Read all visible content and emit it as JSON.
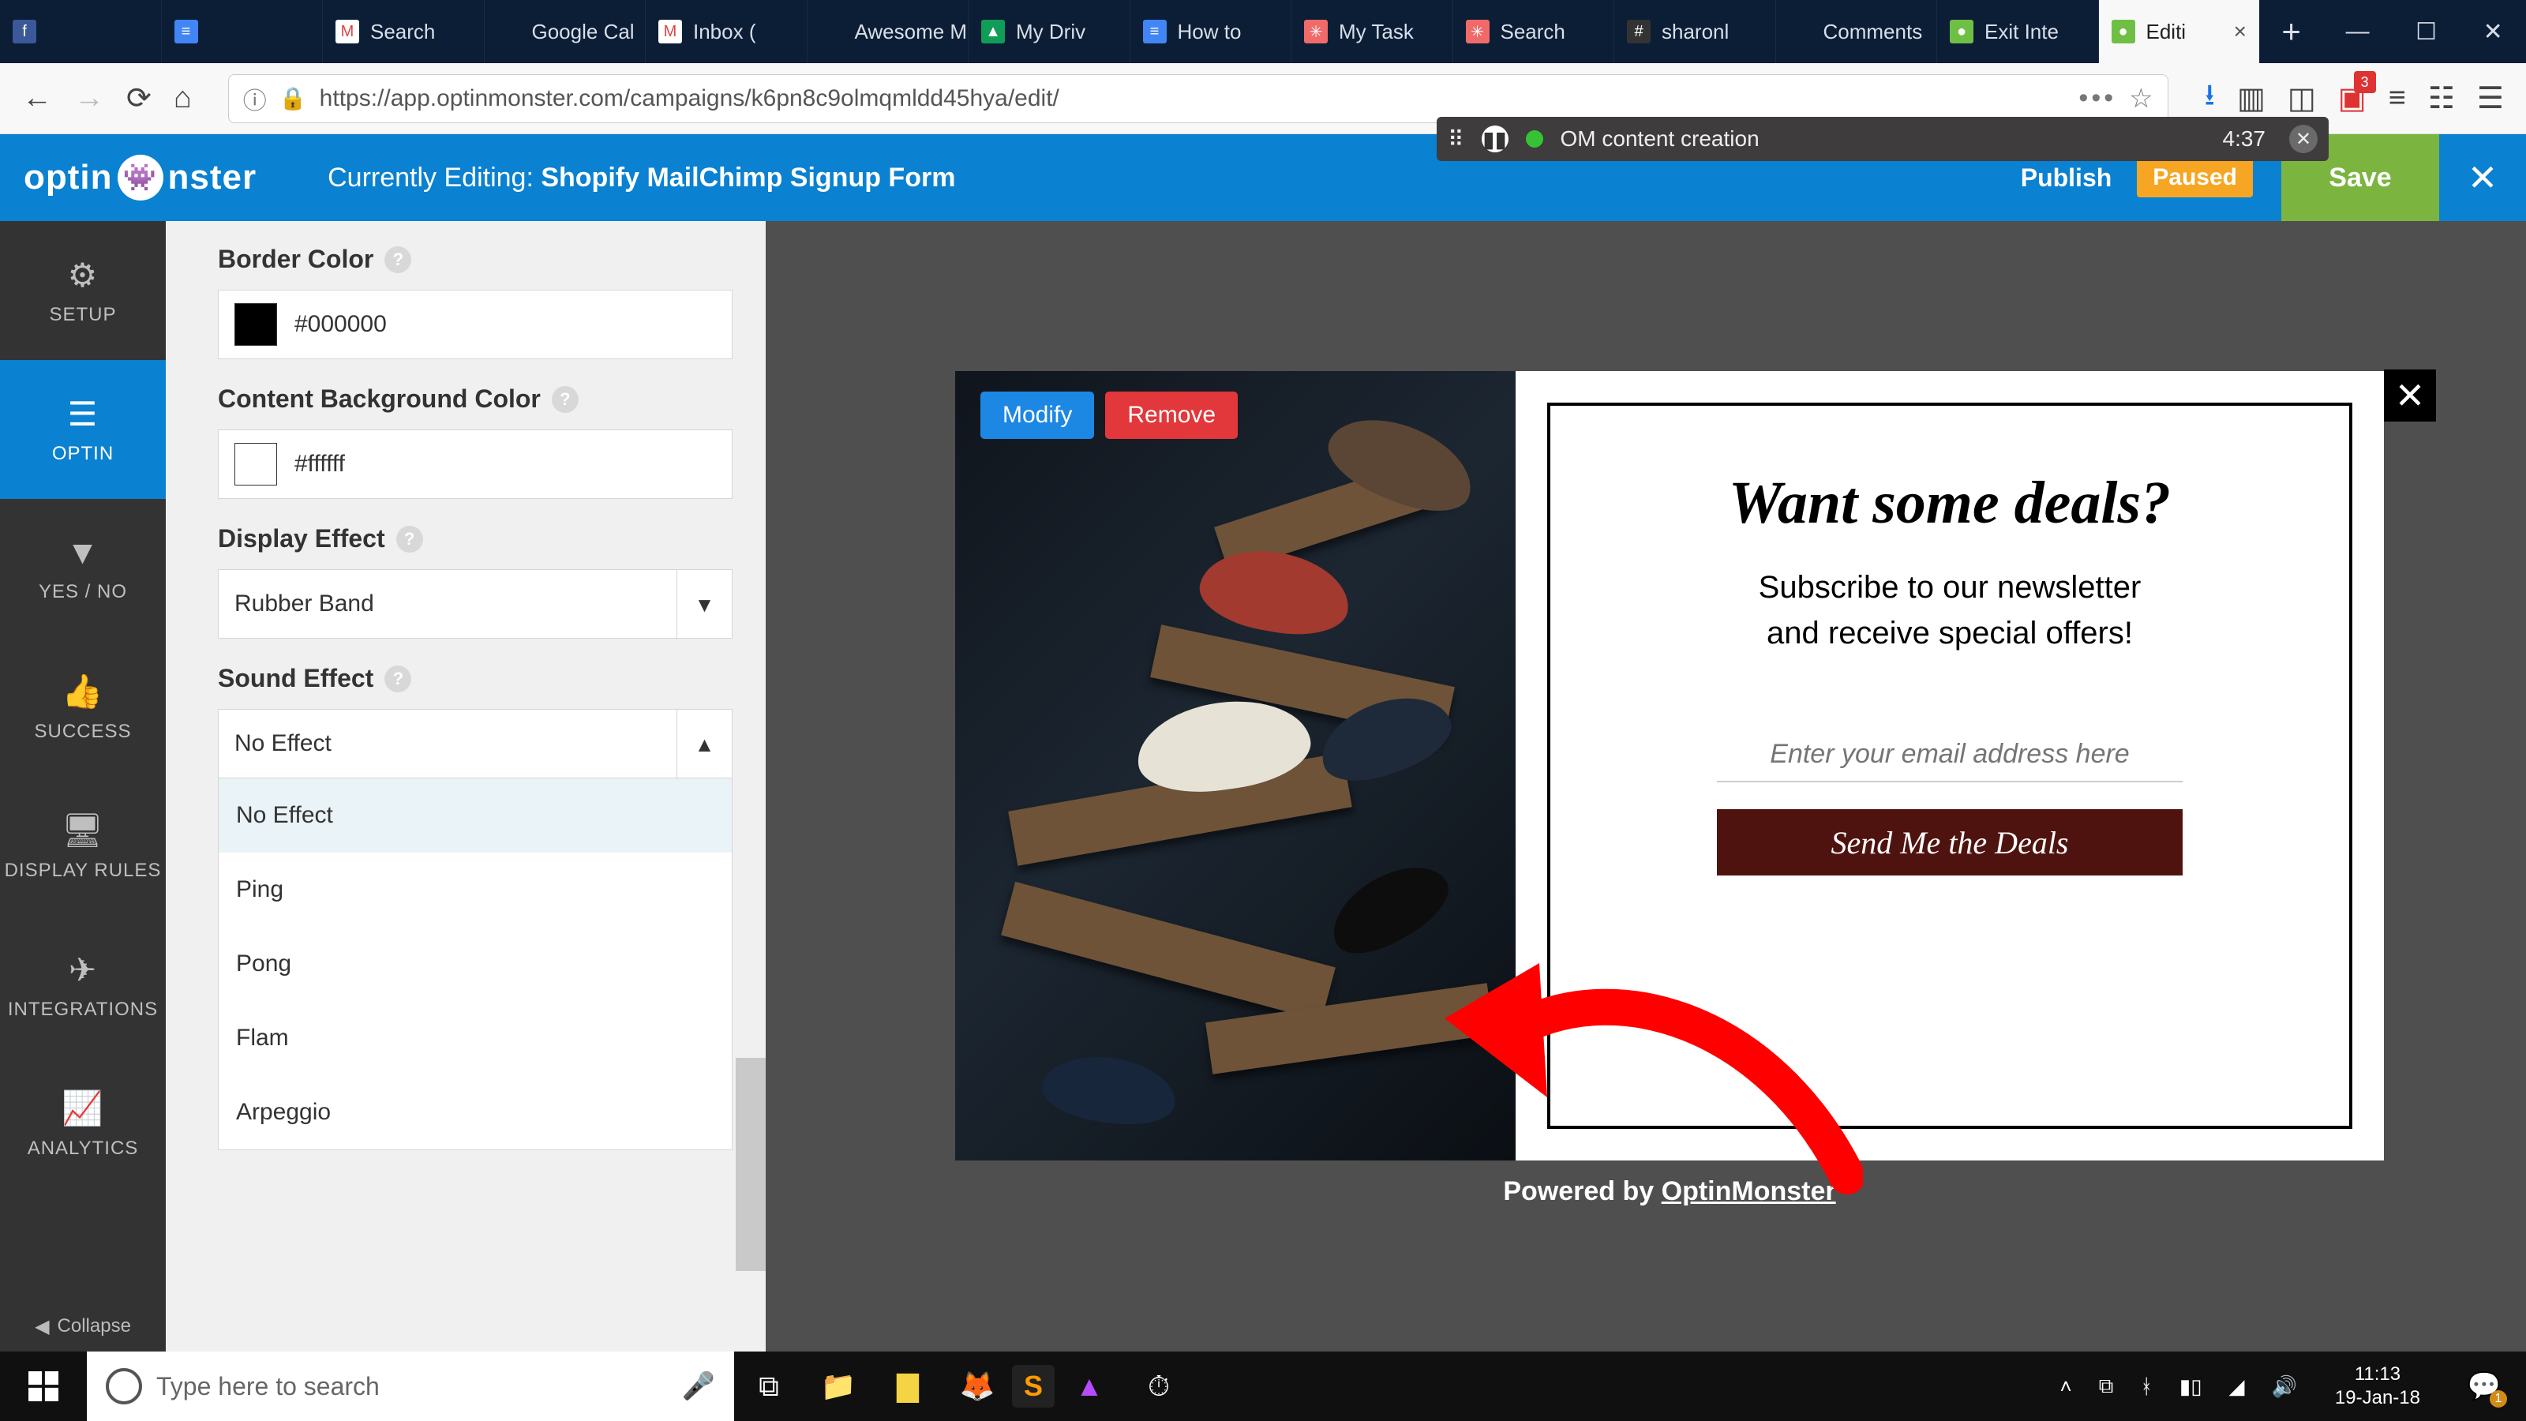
{
  "browser": {
    "tabs": [
      {
        "fav_bg": "#3b5998",
        "fav_txt": "f",
        "label": ""
      },
      {
        "fav_bg": "#4285f4",
        "fav_txt": "≡",
        "label": ""
      },
      {
        "fav_bg": "#ffffff",
        "fav_txt": "M",
        "label": "Search"
      },
      {
        "fav_bg": "",
        "fav_txt": "",
        "label": "Google Cal"
      },
      {
        "fav_bg": "#ffffff",
        "fav_txt": "M",
        "label": "Inbox ("
      },
      {
        "fav_bg": "",
        "fav_txt": "",
        "label": "Awesome M"
      },
      {
        "fav_bg": "#0f9d58",
        "fav_txt": "▲",
        "label": "My Driv"
      },
      {
        "fav_bg": "#4285f4",
        "fav_txt": "≡",
        "label": "How to"
      },
      {
        "fav_bg": "#f06a6a",
        "fav_txt": "✳",
        "label": "My Task"
      },
      {
        "fav_bg": "#f06a6a",
        "fav_txt": "✳",
        "label": "Search"
      },
      {
        "fav_bg": "#333333",
        "fav_txt": "#",
        "label": "sharonl"
      },
      {
        "fav_bg": "",
        "fav_txt": "",
        "label": "Comments"
      },
      {
        "fav_bg": "#6fbf44",
        "fav_txt": "●",
        "label": "Exit Inte"
      },
      {
        "fav_bg": "#6fbf44",
        "fav_txt": "●",
        "label": "Editi"
      }
    ],
    "url": "https://app.optinmonster.com/campaigns/k6pn8c9olmqmldd45hya/edit/",
    "badge_count": "3"
  },
  "recording": {
    "title": "OM content creation",
    "time": "4:37"
  },
  "header": {
    "logo_left": "optin",
    "logo_right": "nster",
    "editing_label": "Currently Editing:",
    "editing_name": "Shopify MailChimp Signup Form",
    "publish": "Publish",
    "paused": "Paused",
    "save": "Save"
  },
  "sidebar": {
    "items": [
      {
        "icon": "⚙",
        "label": "SETUP"
      },
      {
        "icon": "☰",
        "label": "OPTIN"
      },
      {
        "icon": "▼",
        "label": "YES / NO"
      },
      {
        "icon": "👍",
        "label": "SUCCESS"
      },
      {
        "icon": "🖥",
        "label": "DISPLAY RULES"
      },
      {
        "icon": "✈",
        "label": "INTEGRATIONS"
      },
      {
        "icon": "📈",
        "label": "ANALYTICS"
      }
    ],
    "collapse": "Collapse"
  },
  "panel": {
    "border_color_label": "Border Color",
    "border_color_value": "#000000",
    "bg_color_label": "Content Background Color",
    "bg_color_value": "#ffffff",
    "display_effect_label": "Display Effect",
    "display_effect_value": "Rubber Band",
    "sound_effect_label": "Sound Effect",
    "sound_effect_value": "No Effect",
    "sound_options": [
      "No Effect",
      "Ping",
      "Pong",
      "Flam",
      "Arpeggio"
    ]
  },
  "canvas": {
    "modify": "Modify",
    "remove": "Remove",
    "headline": "Want some deals?",
    "sub1": "Subscribe to our newsletter",
    "sub2": "and receive special offers!",
    "placeholder": "Enter your email address here",
    "cta": "Send Me the Deals",
    "powered_prefix": "Powered by ",
    "powered_link": "OptinMonster"
  },
  "taskbar": {
    "search_placeholder": "Type here to search",
    "time": "11:13",
    "date": "19-Jan-18",
    "notif": "1"
  }
}
